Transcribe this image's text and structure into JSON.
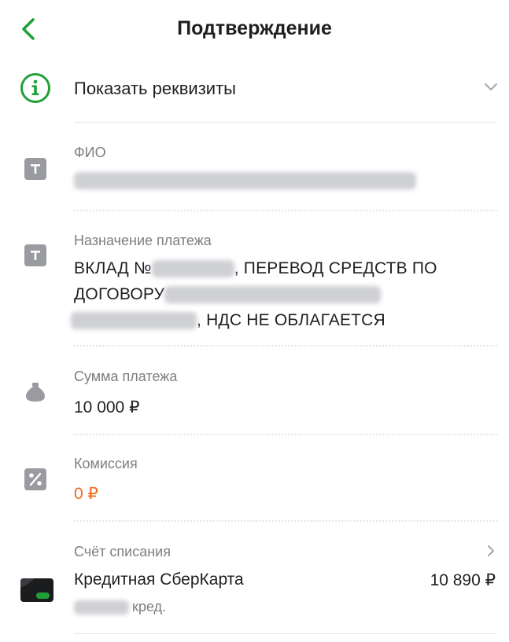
{
  "header": {
    "title": "Подтверждение"
  },
  "details": {
    "show_label": "Показать реквизиты"
  },
  "fields": {
    "fio": {
      "label": "ФИО"
    },
    "purpose": {
      "label": "Назначение платежа",
      "part1": "ВКЛАД №",
      "part2": ", ПЕРЕВОД СРЕДСТВ ПО",
      "part3": "ДОГОВОРУ",
      "part4": ", НДС НЕ ОБЛАГАЕТСЯ"
    },
    "amount": {
      "label": "Сумма платежа",
      "value": "10 000 ₽"
    },
    "commission": {
      "label": "Комиссия",
      "value": "0 ₽"
    }
  },
  "account": {
    "label": "Счёт списания",
    "name": "Кредитная СберКарта",
    "balance": "10 890 ₽",
    "sub": "кред."
  },
  "colors": {
    "accent_green": "#21a038",
    "commission_orange": "#f06a1e",
    "label_gray": "#7d7e83"
  }
}
